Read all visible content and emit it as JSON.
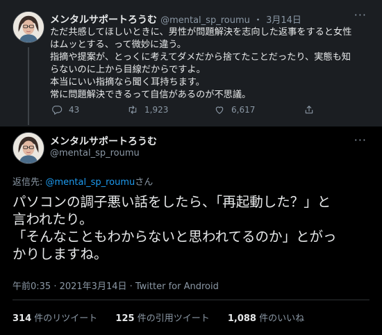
{
  "colors": {
    "top_background": "#1b1e22",
    "main_background": "#000000",
    "text": "#e7e9ea",
    "secondary_text": "#8b98a5",
    "link": "#1d9bf0"
  },
  "previous_tweet": {
    "display_name": "メンタルサポートろうむ",
    "handle": "@mental_sp_roumu",
    "separator": "・",
    "date": "3月14日",
    "lines": [
      "ただ共感してほしいときに、男性が問題解決を志向した返事をすると女性",
      "はムッとする、って微妙に違う。",
      "指摘や提案が、とっくに考えてダメだから捨てたことだったり、実態も知",
      "らないのに上から目線だからですよ。",
      "本当にいい指摘なら聞く耳持ちます。",
      "常に問題解決できるって自信があるのが不思議。"
    ],
    "reply_count": "43",
    "retweet_count": "1,923",
    "like_count": "6,617",
    "icons": [
      "reply-icon",
      "retweet-icon",
      "like-icon",
      "share-icon",
      "more-icon"
    ]
  },
  "main_tweet": {
    "display_name": "メンタルサポートろうむ",
    "handle": "@mental_sp_roumu",
    "reply_to_label": "返信先: ",
    "reply_to_handle": "@mental_sp_roumu",
    "reply_to_suffix": "さん",
    "lines": [
      "パソコンの調子悪い話をしたら、「再起動した？」と",
      "言われたり。",
      "「そんなこともわからないと思われてるのか」とがっ",
      "かりしますね。"
    ],
    "meta": "午前0:35 · 2021年3月14日 · Twitter for Android",
    "retweets_count": "314",
    "retweets_label": " 件のリツイート",
    "quotes_count": "125",
    "quotes_label": " 件の引用ツイート",
    "likes_count": "1,088",
    "likes_label": " 件のいいね"
  }
}
